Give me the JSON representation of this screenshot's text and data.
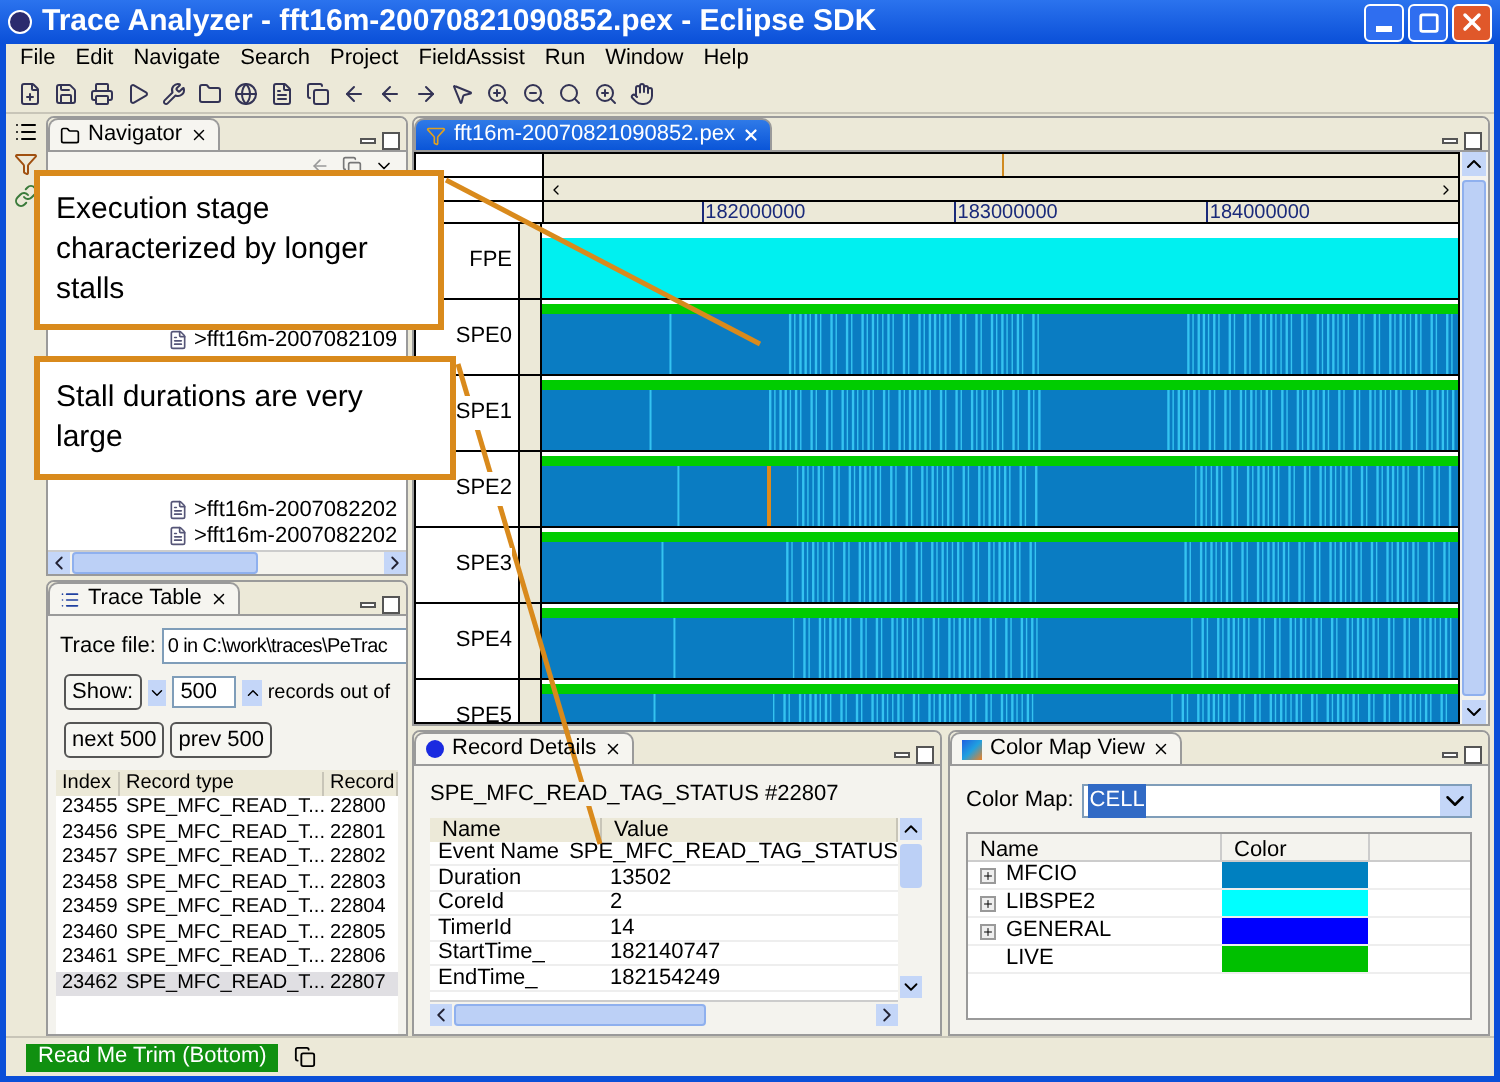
{
  "window": {
    "title": "Trace Analyzer - fft16m-20070821090852.pex - Eclipse SDK"
  },
  "menu": [
    "File",
    "Edit",
    "Navigate",
    "Search",
    "Project",
    "FieldAssist",
    "Run",
    "Window",
    "Help"
  ],
  "navigator": {
    "tab": "Navigator",
    "items": [
      ">fft16m-2007082109",
      ">fft16m-2007082202",
      ">fft16m-2007082202"
    ]
  },
  "trace_table": {
    "tab": "Trace Table",
    "trace_file_label": "Trace file:",
    "trace_file": "0 in C:\\work\\traces\\PeTrac",
    "show_button": "Show:",
    "count": "500",
    "records_label": "records out of",
    "buttons": [
      "next 500",
      "prev 500"
    ],
    "columns": [
      "Index",
      "Record type",
      "Record"
    ],
    "rows": [
      {
        "cells": [
          "23455",
          "SPE_MFC_READ_T...",
          "22800"
        ],
        "selected": false
      },
      {
        "cells": [
          "23456",
          "SPE_MFC_READ_T...",
          "22801"
        ],
        "selected": false
      },
      {
        "cells": [
          "23457",
          "SPE_MFC_READ_T...",
          "22802"
        ],
        "selected": false
      },
      {
        "cells": [
          "23458",
          "SPE_MFC_READ_T...",
          "22803"
        ],
        "selected": false
      },
      {
        "cells": [
          "23459",
          "SPE_MFC_READ_T...",
          "22804"
        ],
        "selected": false
      },
      {
        "cells": [
          "23460",
          "SPE_MFC_READ_T...",
          "22805"
        ],
        "selected": false
      },
      {
        "cells": [
          "23461",
          "SPE_MFC_READ_T...",
          "22806"
        ],
        "selected": false
      },
      {
        "cells": [
          "23462",
          "SPE_MFC_READ_T...",
          "22807"
        ],
        "selected": true
      }
    ]
  },
  "editor": {
    "tab": "fft16m-20070821090852.pex",
    "ticks": [
      "182000000",
      "183000000",
      "184000000"
    ],
    "lanes": [
      {
        "label": "FPE",
        "kind": "plain",
        "marked": false
      },
      {
        "label": "SPE0",
        "kind": "trace",
        "marked": false
      },
      {
        "label": "SPE1",
        "kind": "trace",
        "marked": false
      },
      {
        "label": "SPE2",
        "kind": "trace",
        "marked": true
      },
      {
        "label": "SPE3",
        "kind": "trace",
        "marked": false
      },
      {
        "label": "SPE4",
        "kind": "trace",
        "marked": false
      },
      {
        "label": "SPE5",
        "kind": "trace",
        "marked": false
      }
    ]
  },
  "annotations": [
    "Execution stage characterized by longer stalls",
    "Stall durations are very large"
  ],
  "record_details": {
    "tab": "Record Details",
    "heading": "SPE_MFC_READ_TAG_STATUS #22807",
    "columns": [
      "Name",
      "Value"
    ],
    "rows": [
      {
        "name": "Event Name",
        "value": "SPE_MFC_READ_TAG_STATUS"
      },
      {
        "name": "Duration",
        "value": "13502"
      },
      {
        "name": "CoreId",
        "value": "2"
      },
      {
        "name": "TimerId",
        "value": "14"
      },
      {
        "name": "StartTime_",
        "value": "182140747"
      },
      {
        "name": "EndTime_",
        "value": "182154249"
      }
    ]
  },
  "color_map": {
    "tab": "Color Map View",
    "label": "Color Map:",
    "value": "CELL",
    "columns": [
      "Name",
      "Color"
    ],
    "rows": [
      {
        "name": "MFCIO",
        "color": "#0080c0",
        "expandable": true
      },
      {
        "name": "LIBSPE2",
        "color": "#00ffff",
        "expandable": true
      },
      {
        "name": "GENERAL",
        "color": "#0000ff",
        "expandable": true
      },
      {
        "name": "LIVE",
        "color": "#00c000",
        "expandable": false
      }
    ]
  },
  "status_bar": {
    "trim": "Read Me Trim (Bottom)"
  }
}
